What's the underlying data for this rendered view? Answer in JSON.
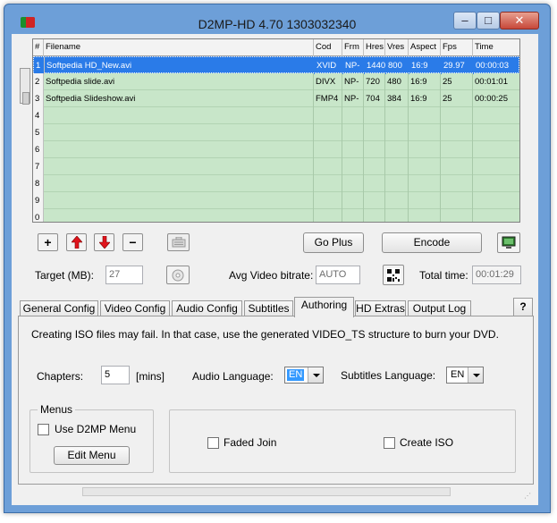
{
  "window": {
    "title": "D2MP-HD 4.70 1303032340",
    "min_symbol": "–",
    "max_symbol": "□",
    "close_symbol": "✕"
  },
  "grid": {
    "headers": [
      "#",
      "Filename",
      "Cod",
      "Frm",
      "Hres",
      "Vres",
      "Aspect",
      "Fps",
      "Time"
    ],
    "rows": [
      {
        "num": "1",
        "file": "Softpedia HD_New.avi",
        "cod": "XVID",
        "frm": "NP-",
        "hres": "1440",
        "vres": "800",
        "aspect": "16:9",
        "fps": "29.97",
        "time": "00:00:03"
      },
      {
        "num": "2",
        "file": "Softpedia slide.avi",
        "cod": "DIVX",
        "frm": "NP-",
        "hres": "720",
        "vres": "480",
        "aspect": "16:9",
        "fps": "25",
        "time": "00:01:01"
      },
      {
        "num": "3",
        "file": "Softpedia Slideshow.avi",
        "cod": "FMP4",
        "frm": "NP-",
        "hres": "704",
        "vres": "384",
        "aspect": "16:9",
        "fps": "25",
        "time": "00:00:25"
      },
      {
        "num": "4"
      },
      {
        "num": "5"
      },
      {
        "num": "6"
      },
      {
        "num": "7"
      },
      {
        "num": "8"
      },
      {
        "num": "9"
      },
      {
        "num": "0"
      }
    ]
  },
  "toolbar": {
    "add_symbol": "+",
    "remove_symbol": "−",
    "go_plus_label": "Go Plus",
    "encode_label": "Encode"
  },
  "settings_row": {
    "target_label": "Target (MB):",
    "target_value": "27",
    "bitrate_label": "Avg Video bitrate:",
    "bitrate_value": "AUTO",
    "total_time_label": "Total time:",
    "total_time_value": "00:01:29"
  },
  "tabs": [
    "General Config",
    "Video Config",
    "Audio Config",
    "Subtitles",
    "Authoring",
    "HD Extras",
    "Output Log"
  ],
  "help_label": "?",
  "authoring": {
    "notice": "Creating ISO files may fail. In that case, use the generated VIDEO_TS structure to burn your DVD.",
    "chapters_label": "Chapters:",
    "chapters_value": "5",
    "chapters_unit": "[mins]",
    "audio_language_label": "Audio Language:",
    "audio_language_value": "EN",
    "subtitles_language_label": "Subtitles Language:",
    "subtitles_language_value": "EN",
    "menus_title": "Menus",
    "use_menu_label": "Use D2MP Menu",
    "edit_menu_label": "Edit Menu",
    "faded_join_label": "Faded Join",
    "create_iso_label": "Create ISO"
  },
  "colors": {
    "titlebar": "#6d9fd8",
    "grid_background": "#c8e6c9",
    "selection": "#2a7be8",
    "arrow_red": "#e0141c"
  }
}
